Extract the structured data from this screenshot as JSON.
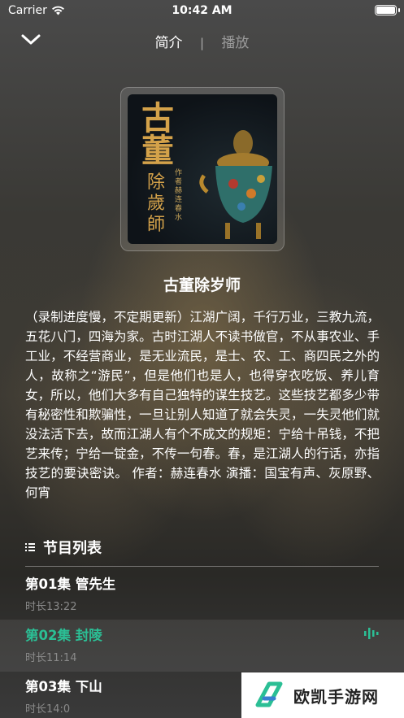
{
  "status_bar": {
    "carrier": "Carrier",
    "time": "10:42 AM"
  },
  "nav": {
    "tabs": [
      {
        "label": "简介",
        "active": true
      },
      {
        "label": "播放",
        "active": false
      }
    ],
    "separator": "|"
  },
  "cover": {
    "title_main": "古董",
    "title_sub": "除歲師",
    "author_line": "作者 赫连春水"
  },
  "book": {
    "title": "古董除岁师",
    "description": "（录制进度慢，不定期更新）江湖广阔，千行万业，三教九流，五花八门，四海为家。古时江湖人不读书做官，不从事农业、手工业，不经营商业，是无业流民，是士、农、工、商四民之外的人，故称之“游民”，但是他们也是人，也得穿衣吃饭、养儿育女，所以，他们大多有自己独特的谋生技艺。这些技艺都多少带有秘密性和欺骗性，一旦让别人知道了就会失灵，一失灵他们就没法活下去，故而江湖人有个不成文的规矩：宁给十吊钱，不把艺来传；宁给一锭金，不传一句春。春，是江湖人的行话，亦指技艺的要诀密诀。 作者：赫连春水 演播：国宝有声、灰原野、何宵"
  },
  "list": {
    "header": "节目列表",
    "episodes": [
      {
        "title": "第01集 管先生",
        "duration": "时长13:22"
      },
      {
        "title": "第02集 封陵",
        "duration": "时长11:14",
        "playing": true
      },
      {
        "title": "第03集 下山",
        "duration": "时长14:0"
      }
    ]
  },
  "ad": {
    "text": "欧凯手游网"
  },
  "colors": {
    "accent": "#2bbf95",
    "gold": "#d4a24a"
  }
}
